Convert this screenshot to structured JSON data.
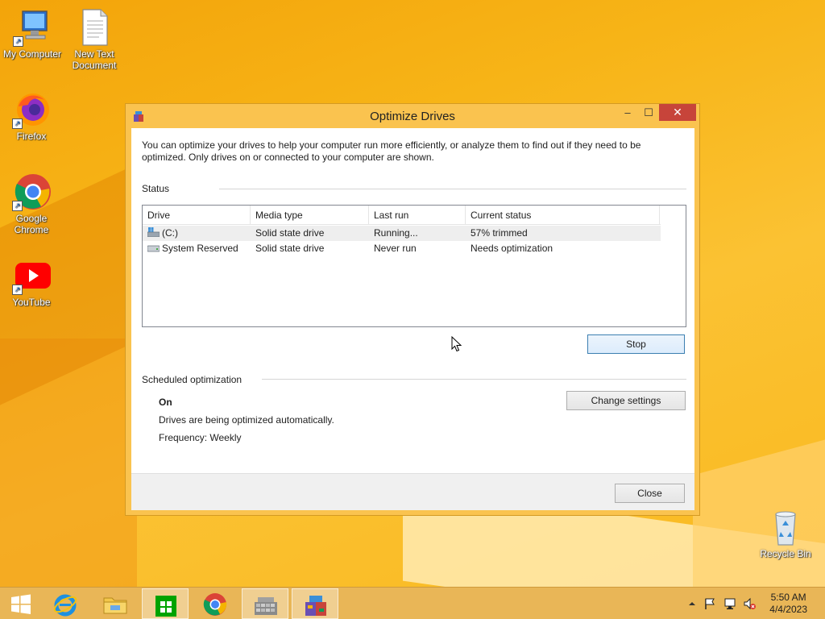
{
  "desktop": {
    "icons": [
      {
        "label_line1": "My Computer",
        "label_line2": ""
      },
      {
        "label_line1": "New Text",
        "label_line2": "Document"
      },
      {
        "label_line1": "Firefox",
        "label_line2": ""
      },
      {
        "label_line1": "Google",
        "label_line2": "Chrome"
      },
      {
        "label_line1": "YouTube",
        "label_line2": ""
      },
      {
        "label_line1": "Recycle Bin",
        "label_line2": ""
      }
    ]
  },
  "window": {
    "title": "Optimize Drives",
    "minimize_glyph": "‒",
    "maximize_glyph": "☐",
    "close_glyph": "✕",
    "description": "You can optimize your drives to help your computer run more efficiently, or analyze them to find out if they need to be optimized. Only drives on or connected to your computer are shown.",
    "status_label": "Status",
    "columns": [
      "Drive",
      "Media type",
      "Last run",
      "Current status"
    ],
    "drives": [
      {
        "drive": "(C:)",
        "media_type": "Solid state drive",
        "last_run": "Running...",
        "current_status": "57% trimmed",
        "icon": "windows-drive-icon"
      },
      {
        "drive": "System Reserved",
        "media_type": "Solid state drive",
        "last_run": "Never run",
        "current_status": "Needs optimization",
        "icon": "drive-icon"
      }
    ],
    "stop_button": "Stop",
    "scheduled_label": "Scheduled optimization",
    "schedule_state": "On",
    "schedule_desc": "Drives are being optimized automatically.",
    "frequency": "Frequency: Weekly",
    "change_settings_button": "Change settings",
    "close_button": "Close"
  },
  "taskbar": {
    "items": [
      "start-icon",
      "internet-explorer-icon",
      "file-explorer-icon",
      "store-icon",
      "chrome-icon",
      "defrag-icon",
      "optimize-drives-icon"
    ],
    "time": "5:50 AM",
    "date": "4/4/2023"
  },
  "colors": {
    "desktop_bg": "#f7b417",
    "window_frame": "#fac34f",
    "close_button": "#c7443a",
    "taskbar": "#e8b65c"
  }
}
